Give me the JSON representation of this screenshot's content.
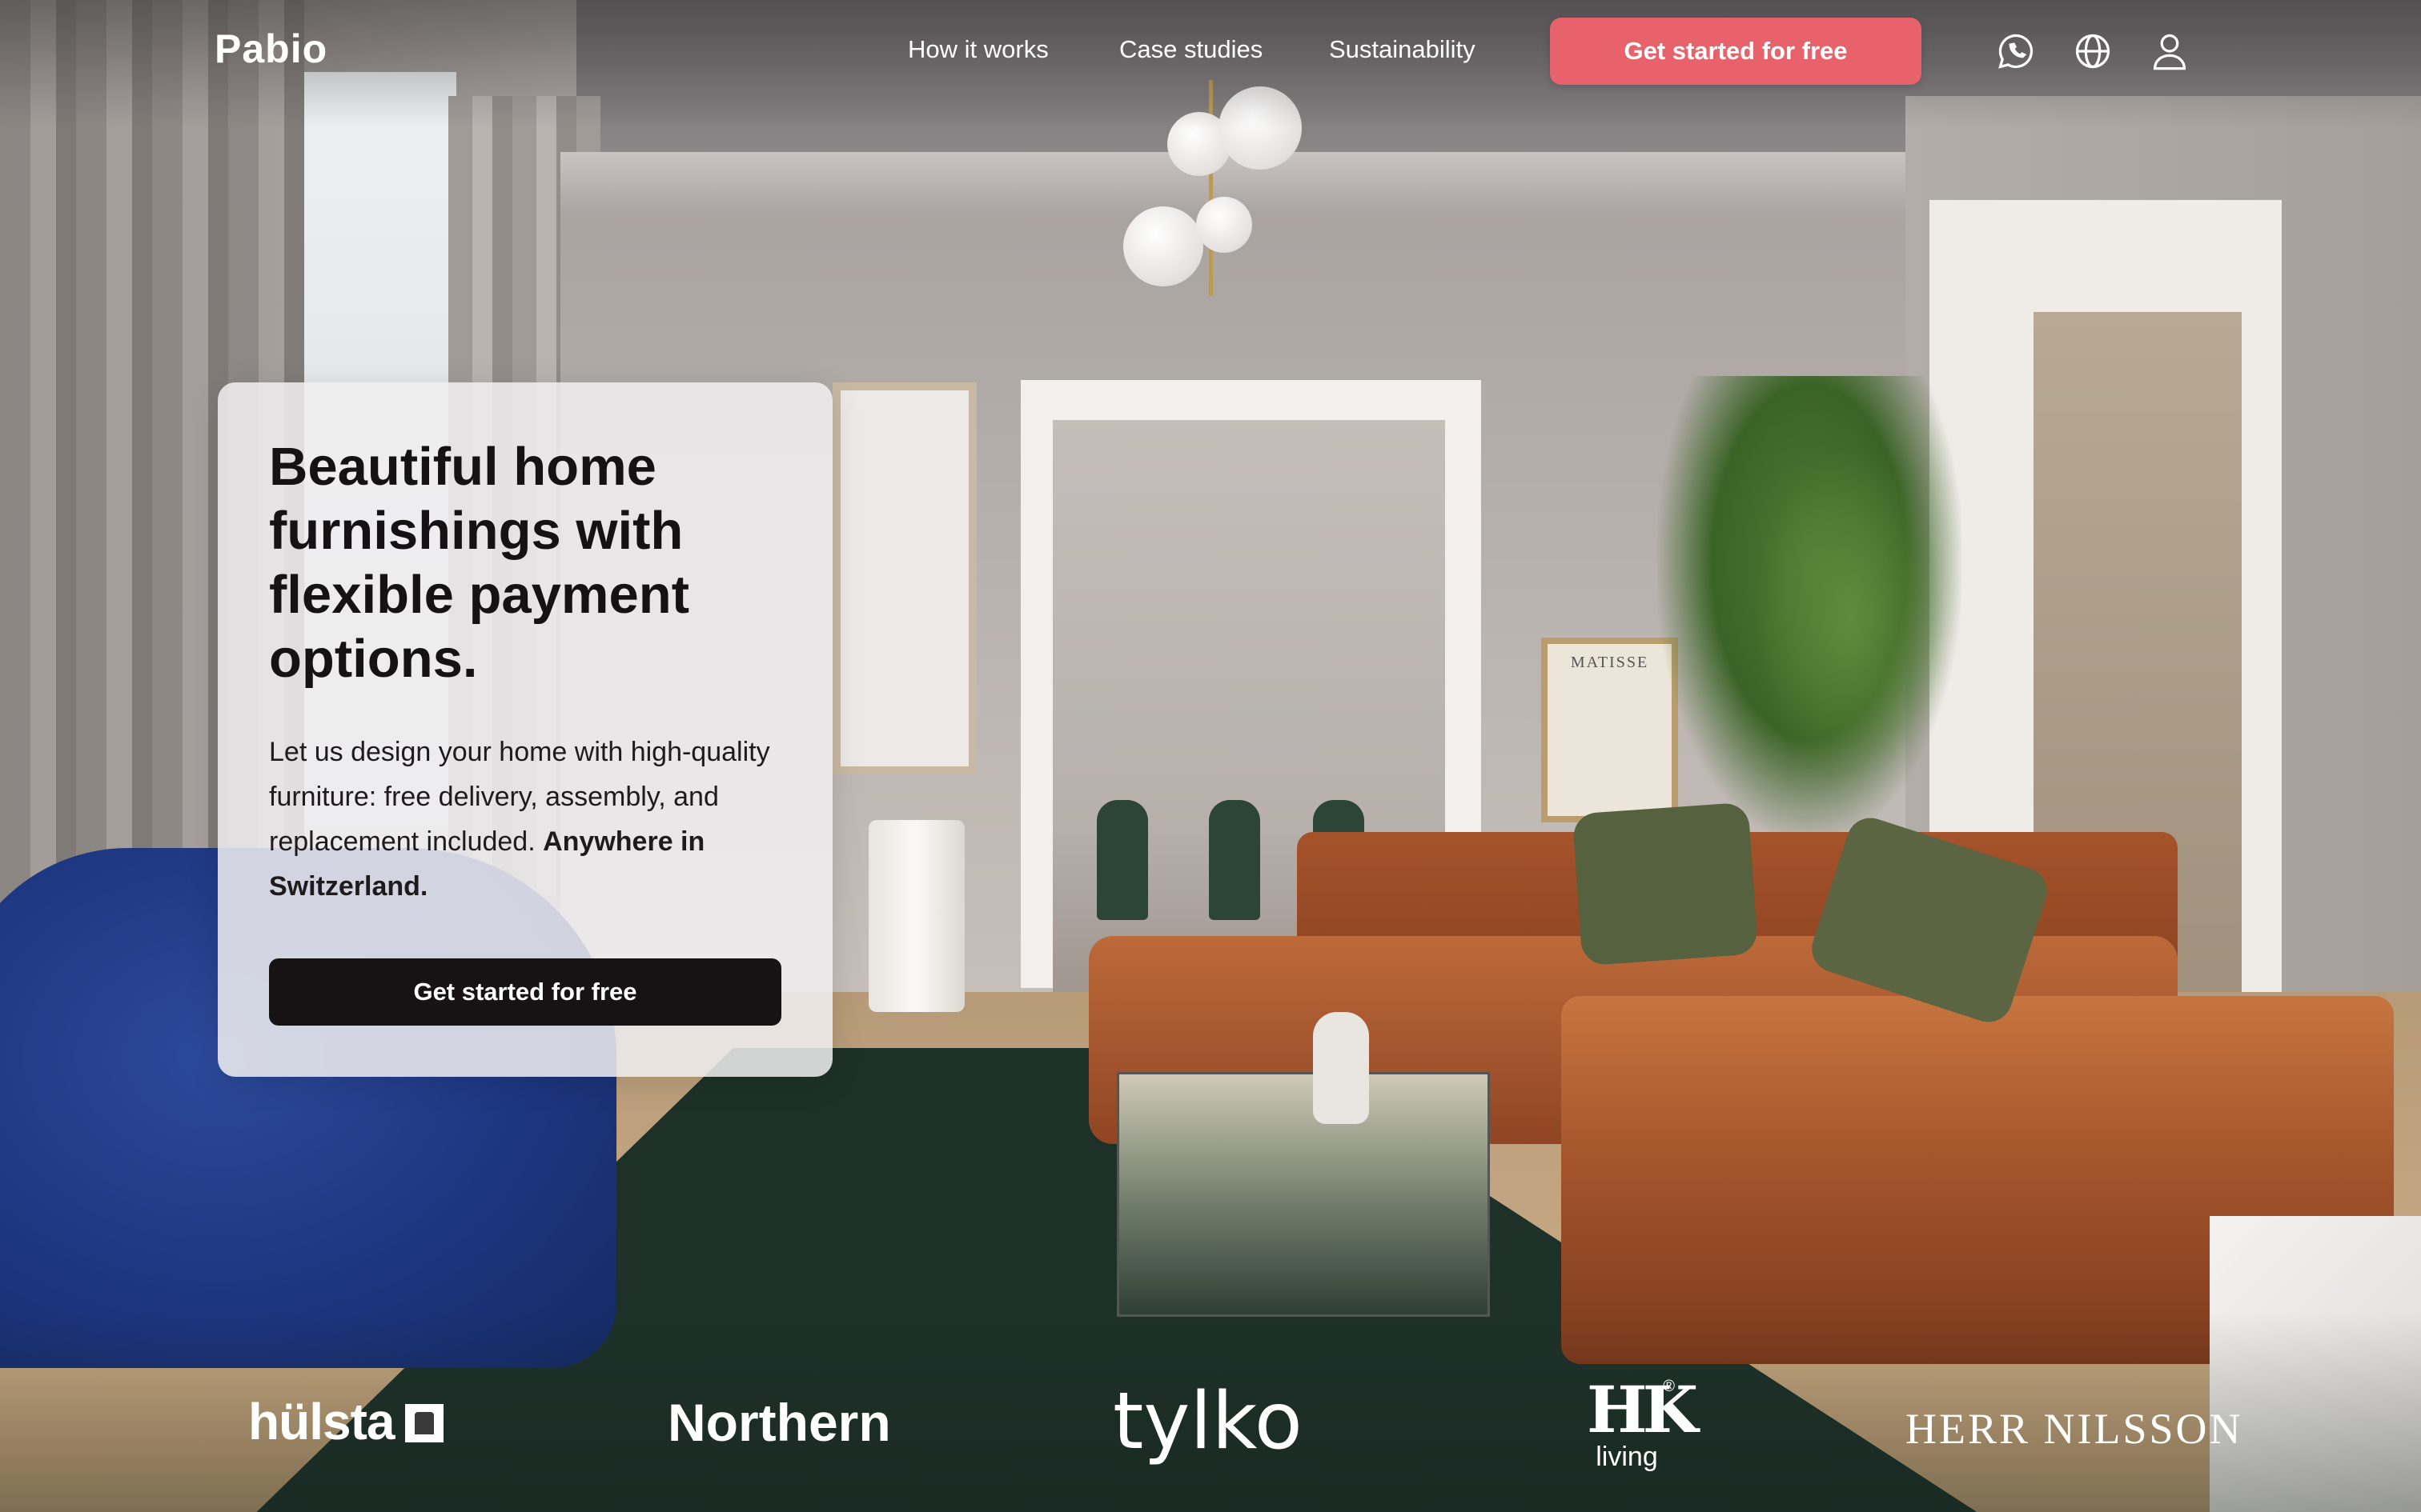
{
  "nav": {
    "logo": "Pabio",
    "links": [
      "How it works",
      "Case studies",
      "Sustainability"
    ],
    "cta_label": "Get started for free",
    "icons": [
      "whatsapp-icon",
      "globe-icon",
      "user-icon"
    ],
    "cta_color": "#e8626b"
  },
  "hero": {
    "title": "Beautiful home furnishings with flexible payment options.",
    "description": "Let us design your home with high-quality furniture: free delivery, assembly, and replacement included.",
    "description_emphasis": "Anywhere in Switzerland.",
    "cta_label": "Get started for free",
    "cta_color": "#171213"
  },
  "brands": {
    "hulsta": "hülsta",
    "northern": "Northern",
    "tylko": "tylko",
    "hk_top": "HK",
    "hk_bottom": "living",
    "hk_reg": "®",
    "herr_nilsson": "HERR NILSSON"
  },
  "background": {
    "matisse_text": "MATISSE"
  }
}
